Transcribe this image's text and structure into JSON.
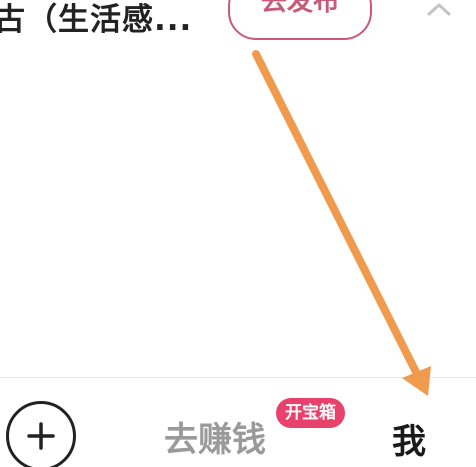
{
  "top": {
    "title_fragment": "古（生活感...",
    "publish_button": "去发布",
    "collapse_icon": "chevron-up-icon"
  },
  "annotation": {
    "arrow_color": "#f09a4e",
    "arrow_icon": "arrow-icon"
  },
  "tabbar": {
    "add_icon": "plus-icon",
    "earn_label": "去赚钱",
    "earn_badge": "开宝箱",
    "me_label": "我"
  },
  "colors": {
    "accent": "#c85a78",
    "badge": "#e8416b",
    "inactive_tab": "#9a9a9a",
    "active_tab": "#1a1a1a"
  }
}
